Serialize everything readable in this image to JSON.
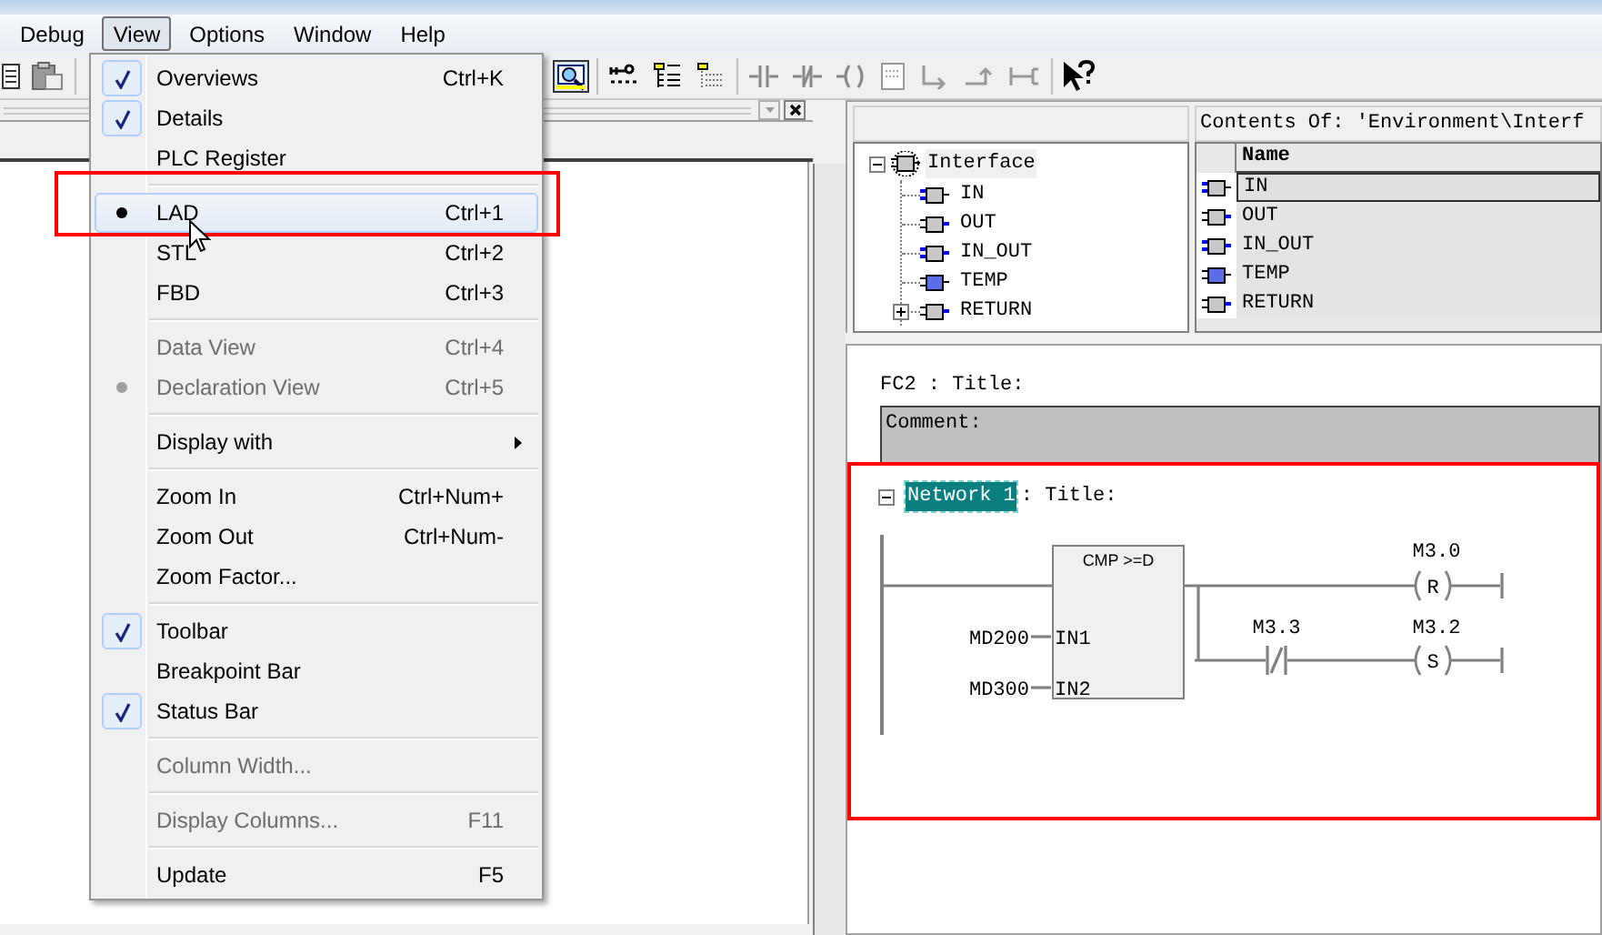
{
  "menubar": [
    {
      "label": "Debug",
      "selected": false
    },
    {
      "label": "View",
      "selected": true
    },
    {
      "label": "Options",
      "selected": false
    },
    {
      "label": "Window",
      "selected": false
    },
    {
      "label": "Help",
      "selected": false
    }
  ],
  "view_menu": [
    {
      "kind": "check",
      "label": "Overviews",
      "shortcut": "Ctrl+K",
      "checked": true,
      "disabled": false,
      "selected": false
    },
    {
      "kind": "check",
      "label": "Details",
      "checked": true,
      "disabled": false,
      "selected": false
    },
    {
      "kind": "check",
      "label": "PLC Register",
      "checked": false,
      "disabled": false,
      "selected": false
    },
    {
      "kind": "separator"
    },
    {
      "kind": "radio",
      "label": "LAD",
      "shortcut": "Ctrl+1",
      "checked": true,
      "disabled": false,
      "selected": true
    },
    {
      "kind": "radio",
      "label": "STL",
      "shortcut": "Ctrl+2",
      "checked": false,
      "disabled": false,
      "selected": false
    },
    {
      "kind": "radio",
      "label": "FBD",
      "shortcut": "Ctrl+3",
      "checked": false,
      "disabled": false,
      "selected": false
    },
    {
      "kind": "separator"
    },
    {
      "kind": "radio",
      "label": "Data View",
      "shortcut": "Ctrl+4",
      "checked": false,
      "disabled": true,
      "selected": false
    },
    {
      "kind": "radio",
      "label": "Declaration View",
      "shortcut": "Ctrl+5",
      "checked": true,
      "disabled": true,
      "selected": false
    },
    {
      "kind": "separator"
    },
    {
      "kind": "submenu",
      "label": "Display with",
      "checked": false,
      "disabled": false,
      "selected": false
    },
    {
      "kind": "separator"
    },
    {
      "kind": "check",
      "label": "Zoom In",
      "shortcut": "Ctrl+Num+",
      "checked": false,
      "disabled": false,
      "selected": false
    },
    {
      "kind": "check",
      "label": "Zoom Out",
      "shortcut": "Ctrl+Num-",
      "checked": false,
      "disabled": false,
      "selected": false
    },
    {
      "kind": "check",
      "label": "Zoom Factor...",
      "checked": false,
      "disabled": false,
      "selected": false
    },
    {
      "kind": "separator"
    },
    {
      "kind": "check",
      "label": "Toolbar",
      "checked": true,
      "disabled": false,
      "selected": false
    },
    {
      "kind": "check",
      "label": "Breakpoint Bar",
      "checked": false,
      "disabled": false,
      "selected": false
    },
    {
      "kind": "check",
      "label": "Status Bar",
      "checked": true,
      "disabled": false,
      "selected": false
    },
    {
      "kind": "separator"
    },
    {
      "kind": "check",
      "label": "Column Width...",
      "checked": false,
      "disabled": true,
      "selected": false
    },
    {
      "kind": "separator"
    },
    {
      "kind": "check",
      "label": "Display Columns...",
      "shortcut": "F11",
      "checked": false,
      "disabled": true,
      "selected": false
    },
    {
      "kind": "separator"
    },
    {
      "kind": "check",
      "label": "Update",
      "shortcut": "F5",
      "checked": false,
      "disabled": false,
      "selected": false
    }
  ],
  "interface_tree": {
    "label": "Interface",
    "kind": "root",
    "expanded": true,
    "children": [
      {
        "label": "IN",
        "kind": "input"
      },
      {
        "label": "OUT",
        "kind": "output"
      },
      {
        "label": "IN_OUT",
        "kind": "inout"
      },
      {
        "label": "TEMP",
        "kind": "temp"
      },
      {
        "label": "RETURN",
        "kind": "output",
        "expanded": false
      }
    ]
  },
  "contents": {
    "title": "Contents Of: 'Environment\\Interf",
    "columns": [
      "Name"
    ],
    "rows": [
      {
        "name": "IN",
        "kind": "input",
        "selected": true
      },
      {
        "name": "OUT",
        "kind": "output",
        "selected": false
      },
      {
        "name": "IN_OUT",
        "kind": "inout",
        "selected": false
      },
      {
        "name": "TEMP",
        "kind": "temp",
        "selected": false
      },
      {
        "name": "RETURN",
        "kind": "output",
        "selected": false
      }
    ]
  },
  "editor": {
    "block_title": "FC2 : Title:",
    "comment": "Comment:",
    "network": {
      "label": "Network 1",
      "title": ": Title:",
      "expanded": true
    },
    "ladder": {
      "block": {
        "title": "CMP >=D",
        "inputs": [
          {
            "pin": "IN1",
            "operand": "MD200"
          },
          {
            "pin": "IN2",
            "operand": "MD300"
          }
        ]
      },
      "coils": [
        {
          "operand": "M3.0",
          "type": "R"
        },
        {
          "operand": "M3.2",
          "type": "S"
        }
      ],
      "contacts": [
        {
          "operand": "M3.3",
          "kind": "normally_closed"
        }
      ]
    }
  }
}
